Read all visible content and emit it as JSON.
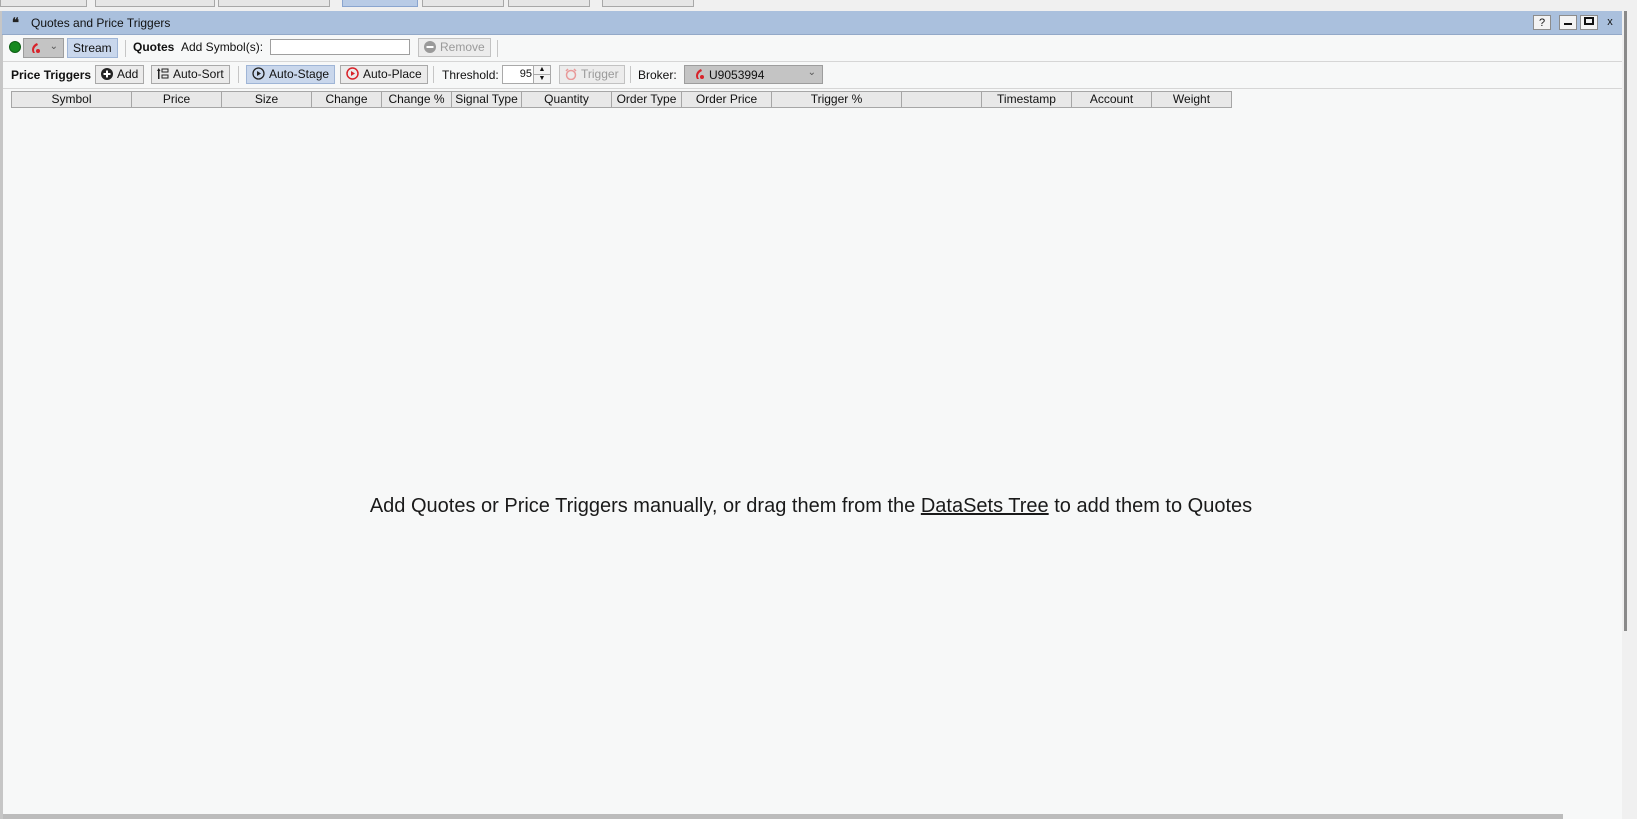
{
  "window": {
    "title": "Quotes and Price Triggers",
    "controls": {
      "help": "?",
      "minimize": "—",
      "maximize": "▭",
      "close": "x"
    }
  },
  "quotes_toolbar": {
    "connection_status": "connected",
    "stream_label": "Stream",
    "section_label": "Quotes",
    "add_symbols_label": "Add Symbol(s):",
    "add_symbols_value": "",
    "remove_label": "Remove"
  },
  "triggers_toolbar": {
    "section_label": "Price Triggers",
    "add_label": "Add",
    "auto_sort_label": "Auto-Sort",
    "auto_stage_label": "Auto-Stage",
    "auto_place_label": "Auto-Place",
    "threshold_label": "Threshold:",
    "threshold_value": "95",
    "trigger_label": "Trigger",
    "broker_label": "Broker:",
    "broker_value": "U9053994"
  },
  "table": {
    "columns": [
      "Symbol",
      "Price",
      "Size",
      "Change",
      "Change %",
      "Signal Type",
      "Quantity",
      "Order Type",
      "Order Price",
      "Trigger %",
      "",
      "Timestamp",
      "Account",
      "Weight"
    ]
  },
  "empty_state": {
    "before_link": "Add Quotes or Price Triggers manually, or drag them from the ",
    "link_text": "DataSets Tree",
    "after_link": " to add them to Quotes"
  },
  "colors": {
    "titlebar": "#aac0dd",
    "pressed_button": "#c9d7ec",
    "status_green": "#16891f",
    "broker_icon_red": "#d8232a"
  }
}
